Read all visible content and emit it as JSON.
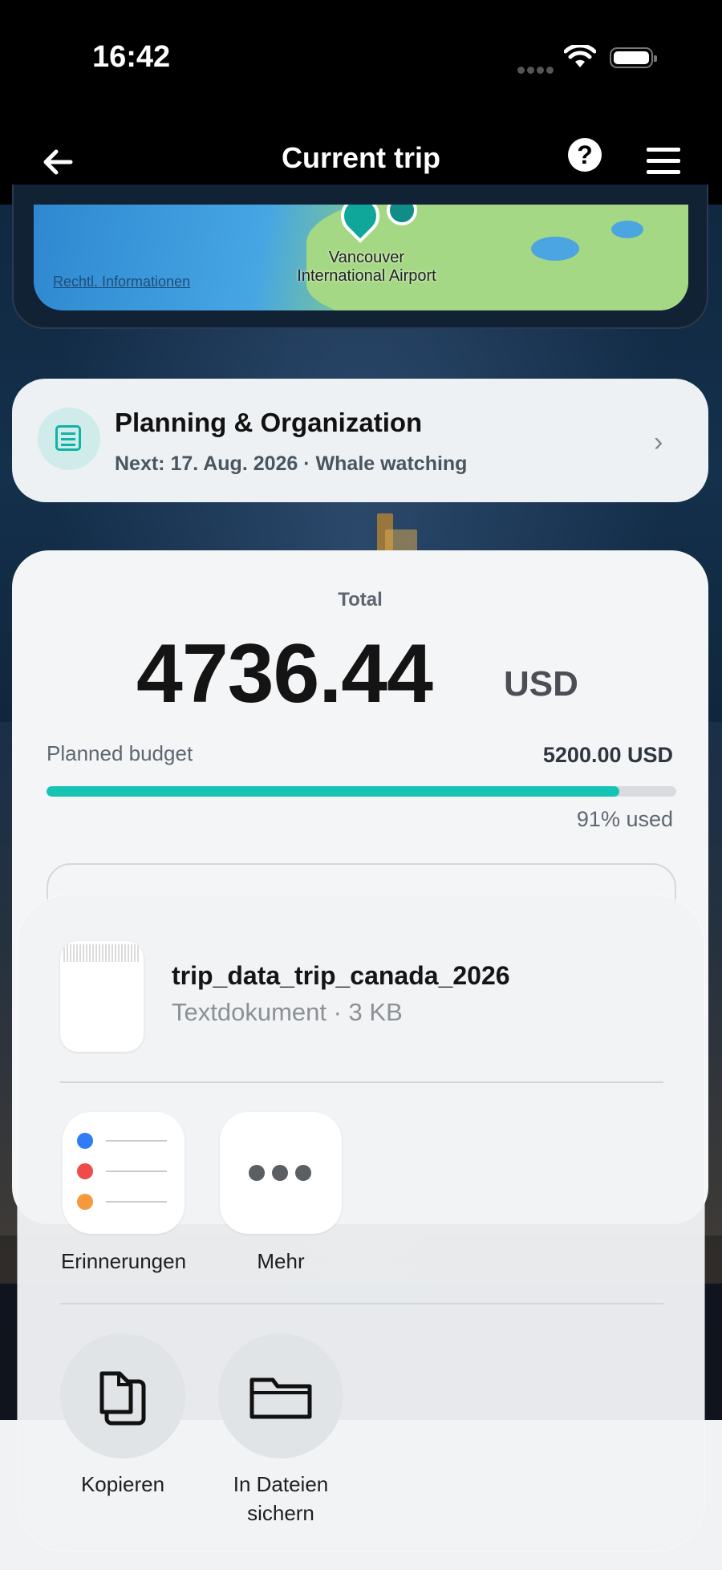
{
  "status_bar": {
    "time": "16:42"
  },
  "nav": {
    "title": "Current trip"
  },
  "map": {
    "airport_label_line1": "Vancouver",
    "airport_label_line2": "International Airport",
    "legal_link": "Rechtl. Informationen"
  },
  "planning": {
    "title": "Planning & Organization",
    "subtitle": "Next: 17. Aug. 2026 · Whale watching"
  },
  "totals": {
    "label": "Total",
    "amount": "4736.44",
    "currency": "USD",
    "budget_label": "Planned budget",
    "budget_value": "5200.00 USD",
    "used_text": "91% used",
    "used_fraction": 0.91
  },
  "share_sheet": {
    "file_name": "trip_data_trip_canada_2026",
    "file_meta": "Textdokument · 3 KB",
    "apps": [
      {
        "label": "Erinnerungen",
        "icon": "reminders-icon"
      },
      {
        "label": "Mehr",
        "icon": "more-icon"
      }
    ],
    "actions": [
      {
        "label": "Kopieren",
        "icon": "copy-icon"
      },
      {
        "label_line1": "In Dateien",
        "label_line2": "sichern",
        "icon": "folder-icon"
      }
    ]
  },
  "colors": {
    "accent": "#16c4b6",
    "reminder_dots": [
      "#2f7cf6",
      "#ef4b4b",
      "#f59a3c"
    ]
  }
}
